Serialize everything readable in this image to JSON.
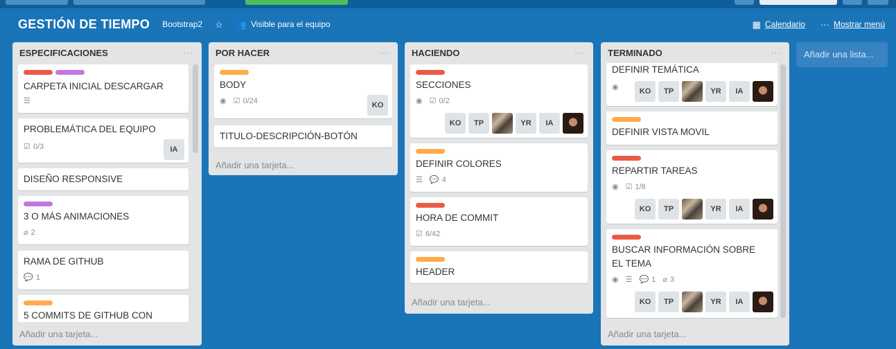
{
  "board": {
    "title": "GESTIÓN DE TIEMPO",
    "team": "Bootstrap2",
    "visibility": "Visible para el equipo",
    "calendar": "Calendario",
    "menu": "Mostrar menú"
  },
  "lists": [
    {
      "title": "ESPECIFICACIONES",
      "menu": "···",
      "add_card": "Añadir una tarjeta...",
      "cards": [
        {
          "title": "CARPETA INICIAL DESCARGAR",
          "labels": [
            "red",
            "purple"
          ],
          "has_description": true
        },
        {
          "title": "PROBLEMÁTICA DEL EQUIPO",
          "checklist": "0/3",
          "members": [
            "IA"
          ]
        },
        {
          "title": "DISEÑO RESPONSIVE"
        },
        {
          "title": "3 O MÁS ANIMACIONES",
          "labels": [
            "purple"
          ],
          "attachments": "2"
        },
        {
          "title": "RAMA DE GITHUB",
          "comments": "1"
        },
        {
          "title": "5 COMMITS DE GITHUB CON",
          "labels": [
            "orange"
          ]
        }
      ]
    },
    {
      "title": "POR HACER",
      "menu": "···",
      "add_card": "Añadir una tarjeta...",
      "cards": [
        {
          "title": "BODY",
          "labels": [
            "orange"
          ],
          "checklist": "0/24",
          "members": [
            "KO"
          ]
        },
        {
          "title": "TITULO-DESCRIPCIÓN-BOTÓN"
        }
      ]
    },
    {
      "title": "HACIENDO",
      "menu": "···",
      "add_card": "Añadir una tarjeta...",
      "cards": [
        {
          "title": "SECCIONES",
          "labels": [
            "red"
          ],
          "checklist": "0/2",
          "members": [
            "KO",
            "TP",
            "photo",
            "YR",
            "IA",
            "photo"
          ]
        },
        {
          "title": "DEFINIR COLORES",
          "labels": [
            "orange"
          ],
          "comments": "4"
        },
        {
          "title": "HORA DE COMMIT",
          "labels": [
            "red"
          ],
          "checklist": "6/42"
        },
        {
          "title": "HEADER",
          "labels": [
            "orange"
          ]
        }
      ]
    },
    {
      "title": "TERMINADO",
      "menu": "···",
      "add_card": "Añadir una tarjeta...",
      "cards": [
        {
          "title": "DEFINIR TEMÁTICA",
          "members": [
            "KO",
            "TP",
            "photo",
            "YR",
            "IA",
            "photo"
          ]
        },
        {
          "title": "DEFINIR VISTA MOVIL",
          "labels": [
            "orange"
          ]
        },
        {
          "title": "REPARTIR TAREAS",
          "labels": [
            "red"
          ],
          "checklist": "1/8",
          "members": [
            "KO",
            "TP",
            "photo",
            "YR",
            "IA",
            "photo"
          ]
        },
        {
          "title_line1": "BUSCAR INFORMACIÓN SOBRE",
          "title_line2": "EL TEMA",
          "labels": [
            "red"
          ],
          "comments": "1",
          "attachments": "3",
          "members": [
            "KO",
            "TP",
            "photo",
            "YR",
            "IA",
            "photo"
          ]
        }
      ]
    }
  ],
  "add_list": "Añadir una lista...",
  "members": {
    "ko": "KO",
    "tp": "TP",
    "yr": "YR",
    "ia": "IA"
  }
}
